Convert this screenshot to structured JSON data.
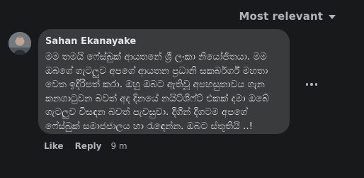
{
  "sort": {
    "label": "Most relevant",
    "icon": "chevron-down-icon"
  },
  "comment": {
    "author": "Sahan Ekanayake",
    "text": "මම තමයි ෆේස්බුක් ආයතනේ ශ්‍රී ලංකා නියෝජිතයා. මම ඔබගේ ගැටලුව අපගේ ආයතන ප්‍රධානි සකර්බර්ග් මහතා වෙත ඉදිරිපත් කරා. ඔහු ඔබට ඇතිවූ අපහසුතාවය ගැන කනගාටුවන බවත් අද දිනයේ නයිට්ශිෆ්ට් එකක් දමා ඔබේ ගැටලුව විසඳන බවත් පැවසුවා. දිගින් දිගටම අපගේ ෆේස්බුක් සමාජජාලය හා රැඳෙන්න. ඔබට ස්තූතියි ..!",
    "more_icon": "more-options-icon",
    "actions": {
      "like": "Like",
      "reply": "Reply",
      "time": "9 m"
    }
  },
  "colors": {
    "background": "#18191a",
    "bubble": "#3a3b3c",
    "primary_text": "#e4e6eb",
    "secondary_text": "#b0b3b8"
  }
}
